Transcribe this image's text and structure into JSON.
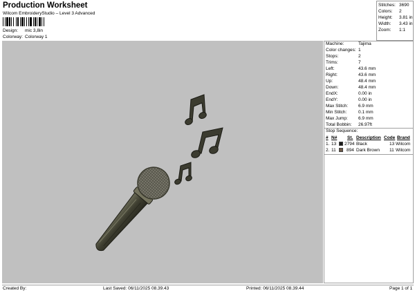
{
  "header": {
    "title": "Production Worksheet",
    "subtitle": "Wilcom EmbroideryStudio – Level 3 Advanced",
    "design_label": "Design:",
    "design_value": "mic 3,8in",
    "colorway_label": "Colorway:",
    "colorway_value": "Colorway 1"
  },
  "stats": [
    {
      "label": "Stitches:",
      "value": "3690"
    },
    {
      "label": "Colors:",
      "value": "2"
    },
    {
      "label": "Height:",
      "value": "3.81 in"
    },
    {
      "label": "Width:",
      "value": "3.43 in"
    },
    {
      "label": "Zoom:",
      "value": "1:1"
    }
  ],
  "machine_info": [
    {
      "label": "Machine:",
      "value": "Tajima"
    },
    {
      "label": "Color changes:",
      "value": "1"
    },
    {
      "label": "Stops:",
      "value": "2"
    },
    {
      "label": "Trims:",
      "value": "7"
    },
    {
      "label": "Left:",
      "value": "43.6 mm"
    },
    {
      "label": "Right:",
      "value": "43.6 mm"
    },
    {
      "label": "Up:",
      "value": "48.4 mm"
    },
    {
      "label": "Down:",
      "value": "48.4 mm"
    },
    {
      "label": "EndX:",
      "value": "0.00 in"
    },
    {
      "label": "EndY:",
      "value": "0.00 in"
    },
    {
      "label": "Max Stitch:",
      "value": "6.9 mm"
    },
    {
      "label": "Min Stitch:",
      "value": "0.1 mm"
    },
    {
      "label": "Max Jump:",
      "value": "6.9 mm"
    },
    {
      "label": "Total Bobbin:",
      "value": "26.97ft"
    }
  ],
  "stop_sequence": {
    "title": "Stop Sequence:",
    "columns": [
      "#",
      "N#",
      "St.",
      "Description",
      "Code",
      "Brand"
    ],
    "rows": [
      {
        "num": "1.",
        "n": "13",
        "st": "2794",
        "desc": "Black",
        "code": "13",
        "brand": "Wilcom",
        "color": "#1a1a1a"
      },
      {
        "num": "2.",
        "n": "11",
        "st": "894",
        "desc": "Dark Brown",
        "code": "11",
        "brand": "Wilcom",
        "color": "#6e5a48"
      }
    ]
  },
  "footer": {
    "created": "Created By:",
    "saved": "Last Saved: 06/11/2025 08.39.43",
    "printed": "Printed: 06/11/2025 08.39.44",
    "page": "Page 1 of 1"
  },
  "design_colors": {
    "dark": "#2a2a22",
    "olive": "#5a5a48",
    "grille": "#6d6b5e",
    "background": "#c0c0c0"
  }
}
